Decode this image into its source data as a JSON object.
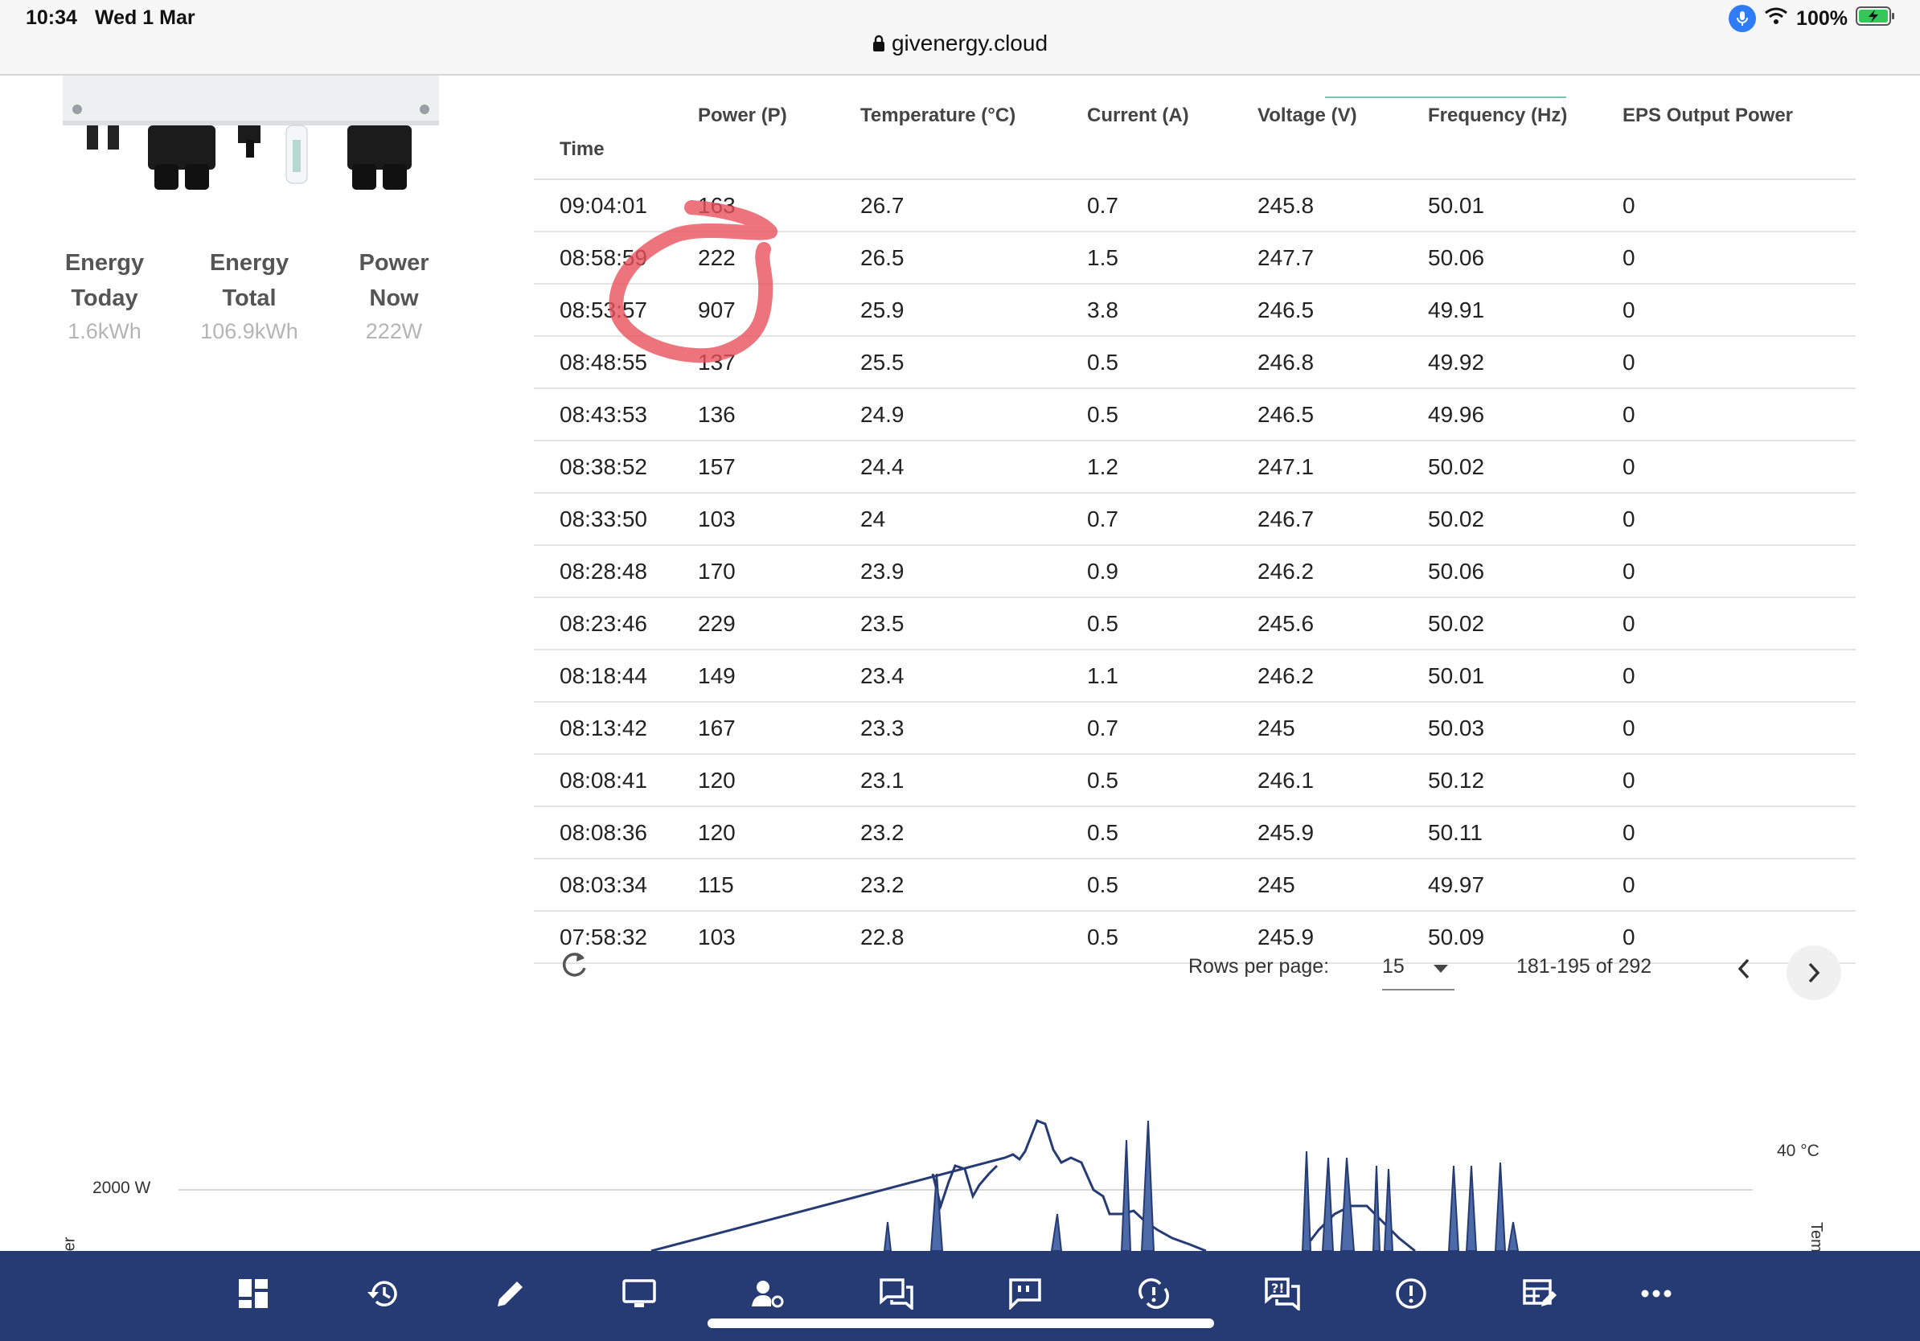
{
  "status_bar": {
    "time": "10:34",
    "date": "Wed 1 Mar",
    "url": "givenergy.cloud",
    "battery": "100%"
  },
  "device": {
    "stats": [
      {
        "label_line1": "Energy",
        "label_line2": "Today",
        "value": "1.6kWh"
      },
      {
        "label_line1": "Energy",
        "label_line2": "Total",
        "value": "106.9kWh"
      },
      {
        "label_line1": "Power",
        "label_line2": "Now",
        "value": "222W"
      }
    ]
  },
  "table": {
    "columns": [
      "Time",
      "Power (P)",
      "Temperature (°C)",
      "Current (A)",
      "Voltage (V)",
      "Frequency (Hz)",
      "EPS Output Power"
    ],
    "rows": [
      [
        "09:04:01",
        "163",
        "26.7",
        "0.7",
        "245.8",
        "50.01",
        "0"
      ],
      [
        "08:58:59",
        "222",
        "26.5",
        "1.5",
        "247.7",
        "50.06",
        "0"
      ],
      [
        "08:53:57",
        "907",
        "25.9",
        "3.8",
        "246.5",
        "49.91",
        "0"
      ],
      [
        "08:48:55",
        "137",
        "25.5",
        "0.5",
        "246.8",
        "49.92",
        "0"
      ],
      [
        "08:43:53",
        "136",
        "24.9",
        "0.5",
        "246.5",
        "49.96",
        "0"
      ],
      [
        "08:38:52",
        "157",
        "24.4",
        "1.2",
        "247.1",
        "50.02",
        "0"
      ],
      [
        "08:33:50",
        "103",
        "24",
        "0.7",
        "246.7",
        "50.02",
        "0"
      ],
      [
        "08:28:48",
        "170",
        "23.9",
        "0.9",
        "246.2",
        "50.06",
        "0"
      ],
      [
        "08:23:46",
        "229",
        "23.5",
        "0.5",
        "245.6",
        "50.02",
        "0"
      ],
      [
        "08:18:44",
        "149",
        "23.4",
        "1.1",
        "246.2",
        "50.01",
        "0"
      ],
      [
        "08:13:42",
        "167",
        "23.3",
        "0.7",
        "245",
        "50.03",
        "0"
      ],
      [
        "08:08:41",
        "120",
        "23.1",
        "0.5",
        "246.1",
        "50.12",
        "0"
      ],
      [
        "08:08:36",
        "120",
        "23.2",
        "0.5",
        "245.9",
        "50.11",
        "0"
      ],
      [
        "08:03:34",
        "115",
        "23.2",
        "0.5",
        "245",
        "49.97",
        "0"
      ],
      [
        "07:58:32",
        "103",
        "22.8",
        "0.5",
        "245.9",
        "50.09",
        "0"
      ]
    ],
    "pagination": {
      "rows_per_page_label": "Rows per page:",
      "rows_per_page_value": "15",
      "range": "181-195 of 292"
    }
  },
  "chart_data": {
    "type": "line",
    "y_left_tick": "2000 W",
    "y_right_tick": "40 °C",
    "y_left_axis_label_fragment": "er",
    "y_right_axis_label_fragment": "Tem",
    "grid": true,
    "line_color": "#263b73"
  },
  "bottom_nav": {
    "items": [
      "dashboard-icon",
      "history-icon",
      "edit-icon",
      "monitor-icon",
      "user-settings-icon",
      "chat-icon",
      "feedback-icon",
      "sync-problem-icon",
      "help-chat-icon",
      "alert-icon",
      "table-edit-icon",
      "more-icon"
    ],
    "background": "#263b73"
  },
  "colors": {
    "accent": "#7fc3b4",
    "annotation": "#e8505b"
  }
}
